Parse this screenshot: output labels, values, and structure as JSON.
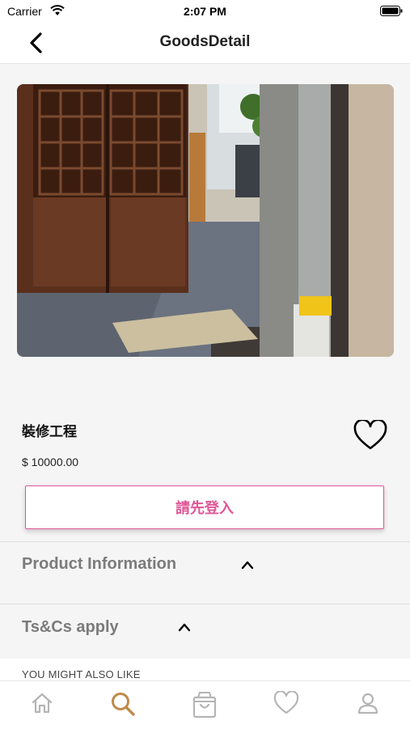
{
  "status_bar": {
    "carrier": "Carrier",
    "time": "2:07 PM",
    "icons": [
      "wifi-icon",
      "battery-icon"
    ]
  },
  "nav": {
    "title": "GoodsDetail",
    "back_icon": "chevron-left-icon"
  },
  "product": {
    "image_icon": "product-photo",
    "name": "裝修工程",
    "price": "$ 10000.00",
    "favorite_icon": "heart-outline-icon"
  },
  "actions": {
    "login_label": "請先登入",
    "login_color": "#e05797"
  },
  "sections": [
    {
      "title": "Product Information",
      "icon": "chevron-up-icon"
    },
    {
      "title": "Ts&Cs apply",
      "icon": "chevron-up-icon"
    }
  ],
  "recommend": {
    "title": "YOU MIGHT ALSO LIKE"
  },
  "tab_bar": {
    "active_color": "#c0894a",
    "inactive_color": "#b5b5b5",
    "tabs": [
      {
        "icon": "home-icon",
        "active": false
      },
      {
        "icon": "search-icon",
        "active": true
      },
      {
        "icon": "shopping-bag-icon",
        "active": false
      },
      {
        "icon": "heart-icon",
        "active": false
      },
      {
        "icon": "user-icon",
        "active": false
      }
    ]
  }
}
